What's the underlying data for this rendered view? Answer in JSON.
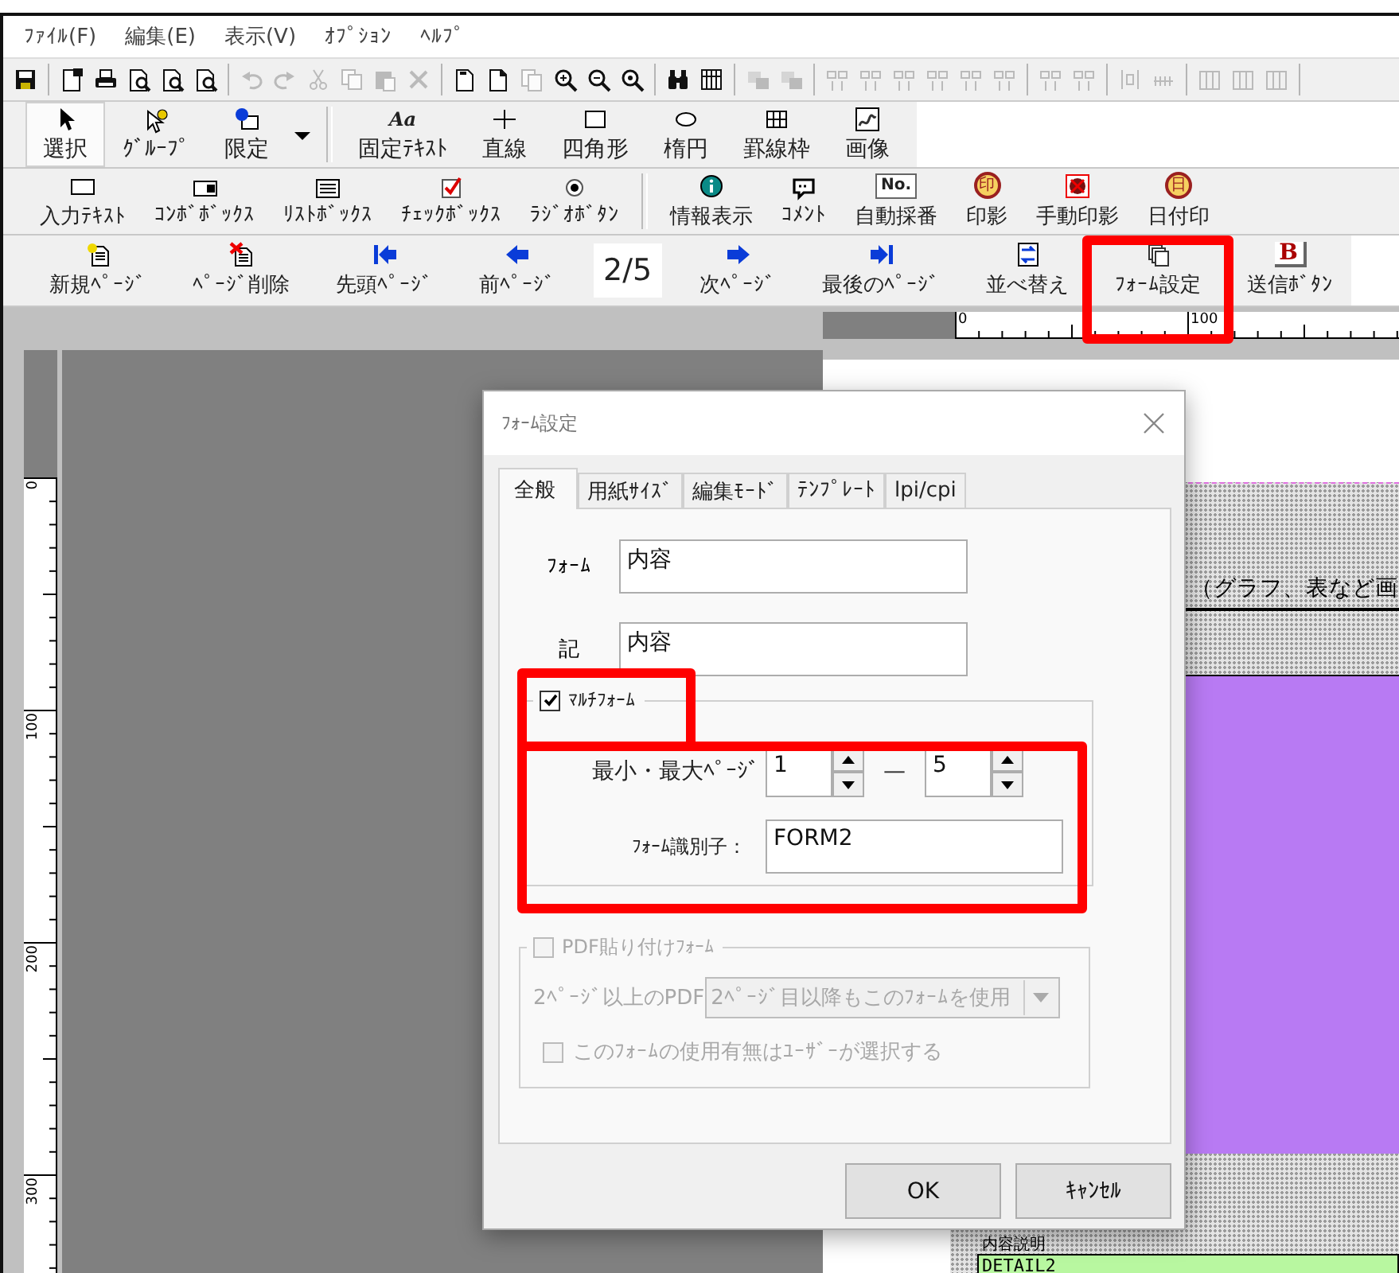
{
  "menu_bar": [
    {
      "label": "ﾌｧｲﾙ(F)"
    },
    {
      "label": "編集(E)"
    },
    {
      "label": "表示(V)"
    },
    {
      "label": "ｵﾌﾟｼｮﾝ"
    },
    {
      "label": "ﾍﾙﾌﾟ"
    }
  ],
  "icon_toolbar": [
    {
      "kind": "icon",
      "disabled": false
    },
    {
      "kind": "separator"
    },
    {
      "kind": "icon",
      "disabled": false
    },
    {
      "kind": "icon",
      "disabled": false
    },
    {
      "kind": "icon",
      "disabled": false
    },
    {
      "kind": "icon",
      "disabled": false
    },
    {
      "kind": "icon",
      "disabled": false
    },
    {
      "kind": "separator"
    },
    {
      "kind": "icon",
      "disabled": true
    },
    {
      "kind": "icon",
      "disabled": true
    },
    {
      "kind": "icon",
      "disabled": true
    },
    {
      "kind": "icon",
      "disabled": true
    },
    {
      "kind": "icon",
      "disabled": true
    },
    {
      "kind": "icon",
      "disabled": true
    },
    {
      "kind": "separator"
    },
    {
      "kind": "icon",
      "disabled": false
    },
    {
      "kind": "icon",
      "disabled": false
    },
    {
      "kind": "icon",
      "disabled": true
    },
    {
      "kind": "icon",
      "disabled": false
    },
    {
      "kind": "icon",
      "disabled": false
    },
    {
      "kind": "icon",
      "disabled": false
    },
    {
      "kind": "separator"
    },
    {
      "kind": "icon",
      "disabled": false
    },
    {
      "kind": "icon",
      "disabled": false
    },
    {
      "kind": "separator"
    },
    {
      "kind": "icon",
      "disabled": true
    },
    {
      "kind": "icon",
      "disabled": true
    },
    {
      "kind": "separator"
    },
    {
      "kind": "icon",
      "disabled": true
    },
    {
      "kind": "icon",
      "disabled": true
    },
    {
      "kind": "icon",
      "disabled": true
    },
    {
      "kind": "icon",
      "disabled": true
    },
    {
      "kind": "icon",
      "disabled": true
    },
    {
      "kind": "icon",
      "disabled": true
    },
    {
      "kind": "separator"
    },
    {
      "kind": "icon",
      "disabled": true
    },
    {
      "kind": "icon",
      "disabled": true
    },
    {
      "kind": "separator"
    },
    {
      "kind": "icon",
      "disabled": true
    },
    {
      "kind": "icon",
      "disabled": true
    },
    {
      "kind": "separator"
    },
    {
      "kind": "icon",
      "disabled": true
    },
    {
      "kind": "icon",
      "disabled": true
    },
    {
      "kind": "icon",
      "disabled": true
    },
    {
      "kind": "separator"
    }
  ],
  "toolbars": [
    {
      "items": [
        {
          "kind": "tool",
          "label": "選択",
          "selected": true
        },
        {
          "kind": "tool",
          "label": "ｸﾞﾙｰﾌﾟ",
          "selected": false
        },
        {
          "kind": "tool",
          "label": "限定",
          "selected": false
        },
        {
          "kind": "dropdown"
        },
        {
          "kind": "separator"
        },
        {
          "kind": "tool",
          "label": "固定ﾃｷｽﾄ",
          "glyph": "Aa",
          "selected": false
        },
        {
          "kind": "tool",
          "label": "直線",
          "selected": false
        },
        {
          "kind": "tool",
          "label": "四角形",
          "selected": false
        },
        {
          "kind": "tool",
          "label": "楕円",
          "selected": false
        },
        {
          "kind": "tool",
          "label": "罫線枠",
          "selected": false
        },
        {
          "kind": "tool",
          "label": "画像",
          "selected": false
        }
      ]
    },
    {
      "items": [
        {
          "kind": "tool",
          "label": "入力ﾃｷｽﾄ",
          "selected": false
        },
        {
          "kind": "tool",
          "label": "ｺﾝﾎﾞﾎﾞｯｸｽ",
          "selected": false
        },
        {
          "kind": "tool",
          "label": "ﾘｽﾄﾎﾞｯｸｽ",
          "selected": false
        },
        {
          "kind": "tool",
          "label": "ﾁｪｯｸﾎﾞｯｸｽ",
          "selected": false
        },
        {
          "kind": "tool",
          "label": "ﾗｼﾞｵﾎﾞﾀﾝ",
          "selected": false
        },
        {
          "kind": "separator"
        },
        {
          "kind": "tool",
          "label": "情報表示",
          "selected": false
        },
        {
          "kind": "tool",
          "label": "ｺﾒﾝﾄ",
          "selected": false
        },
        {
          "kind": "tool",
          "label": "自動採番",
          "glyph": "No.",
          "selected": false
        },
        {
          "kind": "tool",
          "label": "印影",
          "glyph": "印",
          "selected": false
        },
        {
          "kind": "tool",
          "label": "手動印影",
          "selected": false
        },
        {
          "kind": "tool",
          "label": "日付印",
          "glyph": "日",
          "selected": false
        }
      ]
    },
    {
      "items": [
        {
          "kind": "action",
          "label": "新規ﾍﾟｰｼﾞ"
        },
        {
          "kind": "action",
          "label": "ﾍﾟｰｼﾞ削除"
        },
        {
          "kind": "action",
          "label": "先頭ﾍﾟｰｼﾞ"
        },
        {
          "kind": "action",
          "label": "前ﾍﾟｰｼﾞ"
        },
        {
          "kind": "indicator",
          "label": "2/5"
        },
        {
          "kind": "action",
          "label": "次ﾍﾟｰｼﾞ"
        },
        {
          "kind": "action",
          "label": "最後のﾍﾟｰｼﾞ"
        },
        {
          "kind": "action",
          "label": "並べ替え"
        },
        {
          "kind": "action",
          "label": "ﾌｫｰﾑ設定"
        },
        {
          "kind": "action",
          "label": "送信ﾎﾞﾀﾝ",
          "glyph": "B"
        }
      ]
    }
  ],
  "workspace": {
    "vertical_ruler": [
      "0",
      "100",
      "200",
      "300"
    ],
    "horizontal_ruler": [
      "0",
      "100"
    ],
    "page": {
      "heading": "（グラフ、表など画",
      "field_label": "内容説明",
      "field_value": "DETAIL2"
    }
  },
  "dialog": {
    "title": "ﾌｫｰﾑ設定",
    "tabs": [
      {
        "label": "全般",
        "selected": true
      },
      {
        "label": "用紙ｻｲｽﾞ",
        "selected": false
      },
      {
        "label": "編集ﾓｰﾄﾞ",
        "selected": false
      },
      {
        "label": "ﾃﾝﾌﾟﾚｰﾄ",
        "selected": false
      },
      {
        "label": "lpi/cpi",
        "selected": false
      }
    ],
    "fields": [
      {
        "label": "ﾌｫｰﾑ",
        "value": "内容"
      },
      {
        "label": "記",
        "value": "内容"
      }
    ],
    "multi_form": {
      "label": "ﾏﾙﾁﾌｫｰﾑ",
      "checked": true,
      "page_range": {
        "label": "最小・最大ﾍﾟｰｼﾞ",
        "min": "1",
        "separator": "—",
        "max": "5"
      },
      "identifier": {
        "label": "ﾌｫｰﾑ識別子：",
        "value": "FORM2"
      }
    },
    "pdf_form": {
      "label": "PDF貼り付けﾌｫｰﾑ",
      "checked": false,
      "disabled": true,
      "pdf_label": "2ﾍﾟｰｼﾞ以上のPDF",
      "dropdown": "2ﾍﾟｰｼﾞ目以降もこのﾌｫｰﾑを使用",
      "user_select": {
        "label": "このﾌｫｰﾑの使用有無はﾕｰｻﾞｰが選択する",
        "checked": false
      }
    },
    "buttons": [
      {
        "label": "OK"
      },
      {
        "label": "ｷｬﾝｾﾙ"
      }
    ]
  }
}
